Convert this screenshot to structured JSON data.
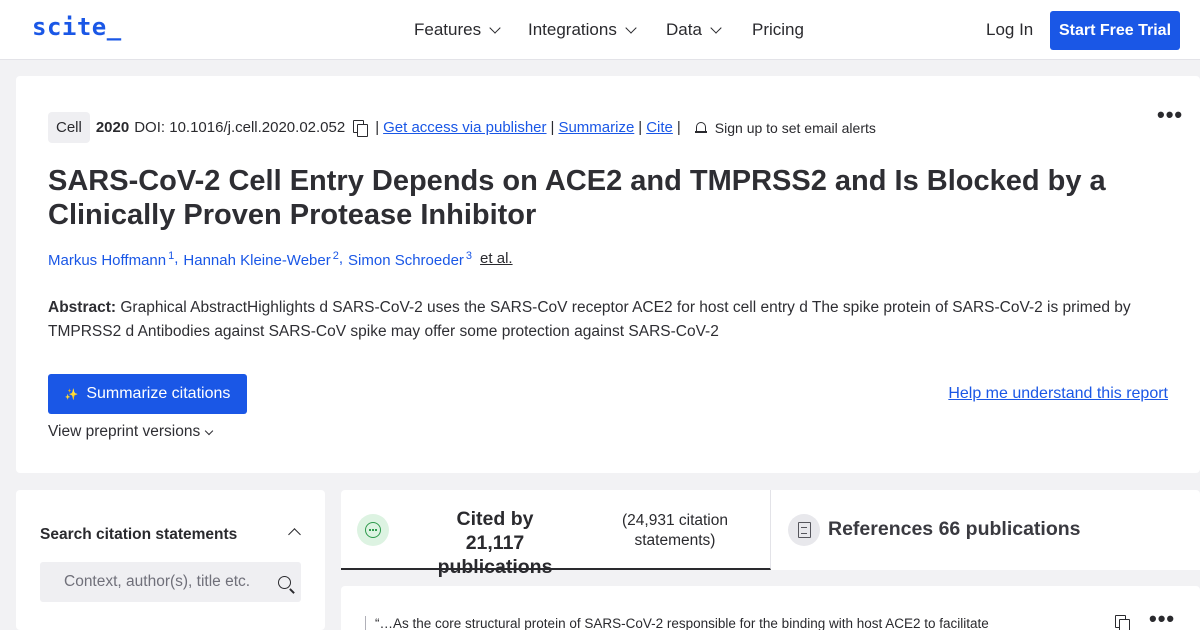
{
  "nav": {
    "logo": "scite_",
    "items": [
      {
        "label": "Features",
        "has_dropdown": true
      },
      {
        "label": "Integrations",
        "has_dropdown": true
      },
      {
        "label": "Data",
        "has_dropdown": true
      },
      {
        "label": "Pricing",
        "has_dropdown": false
      }
    ],
    "login": "Log In",
    "trial": "Start Free Trial"
  },
  "article": {
    "journal": "Cell",
    "year": "2020",
    "doi": "DOI: 10.1016/j.cell.2020.02.052",
    "links": {
      "access": "Get access via publisher",
      "summarize": "Summarize",
      "cite": "Cite"
    },
    "separator": "|",
    "alerts": "Sign up to set email alerts",
    "more": "•••",
    "title": "SARS-CoV-2 Cell Entry Depends on ACE2 and TMPRSS2 and Is Blocked by a Clinically Proven Protease Inhibitor",
    "authors": [
      {
        "name": "Markus Hoffmann",
        "sup": "1"
      },
      {
        "name": "Hannah Kleine-Weber",
        "sup": "2"
      },
      {
        "name": "Simon Schroeder",
        "sup": "3"
      }
    ],
    "author_separator": ",",
    "et_al": "et al.",
    "abstract_label": "Abstract:",
    "abstract_text": "Graphical AbstractHighlights d SARS-CoV-2 uses the SARS-CoV receptor ACE2 for host cell entry d The spike protein of SARS-CoV-2 is primed by TMPRSS2 d Antibodies against SARS-CoV spike may offer some protection against SARS-CoV-2",
    "summarize_button": "Summarize citations",
    "preprint": "View preprint versions",
    "help": "Help me understand this report"
  },
  "search": {
    "title": "Search citation statements",
    "placeholder": "Context, author(s), title etc."
  },
  "tabs": {
    "cited_title": "Cited by 21,117 publications",
    "cited_sub": "(24,931 citation statements)",
    "references": "References 66 publications"
  },
  "citation": {
    "snippet": "“…As the core structural protein of SARS-CoV-2 responsible for the binding with host ACE2 to facilitate",
    "more": "•••"
  },
  "colors": {
    "accent": "#1a57e6",
    "background": "#f2f2f4",
    "cited_icon": "#2e9a4c"
  }
}
